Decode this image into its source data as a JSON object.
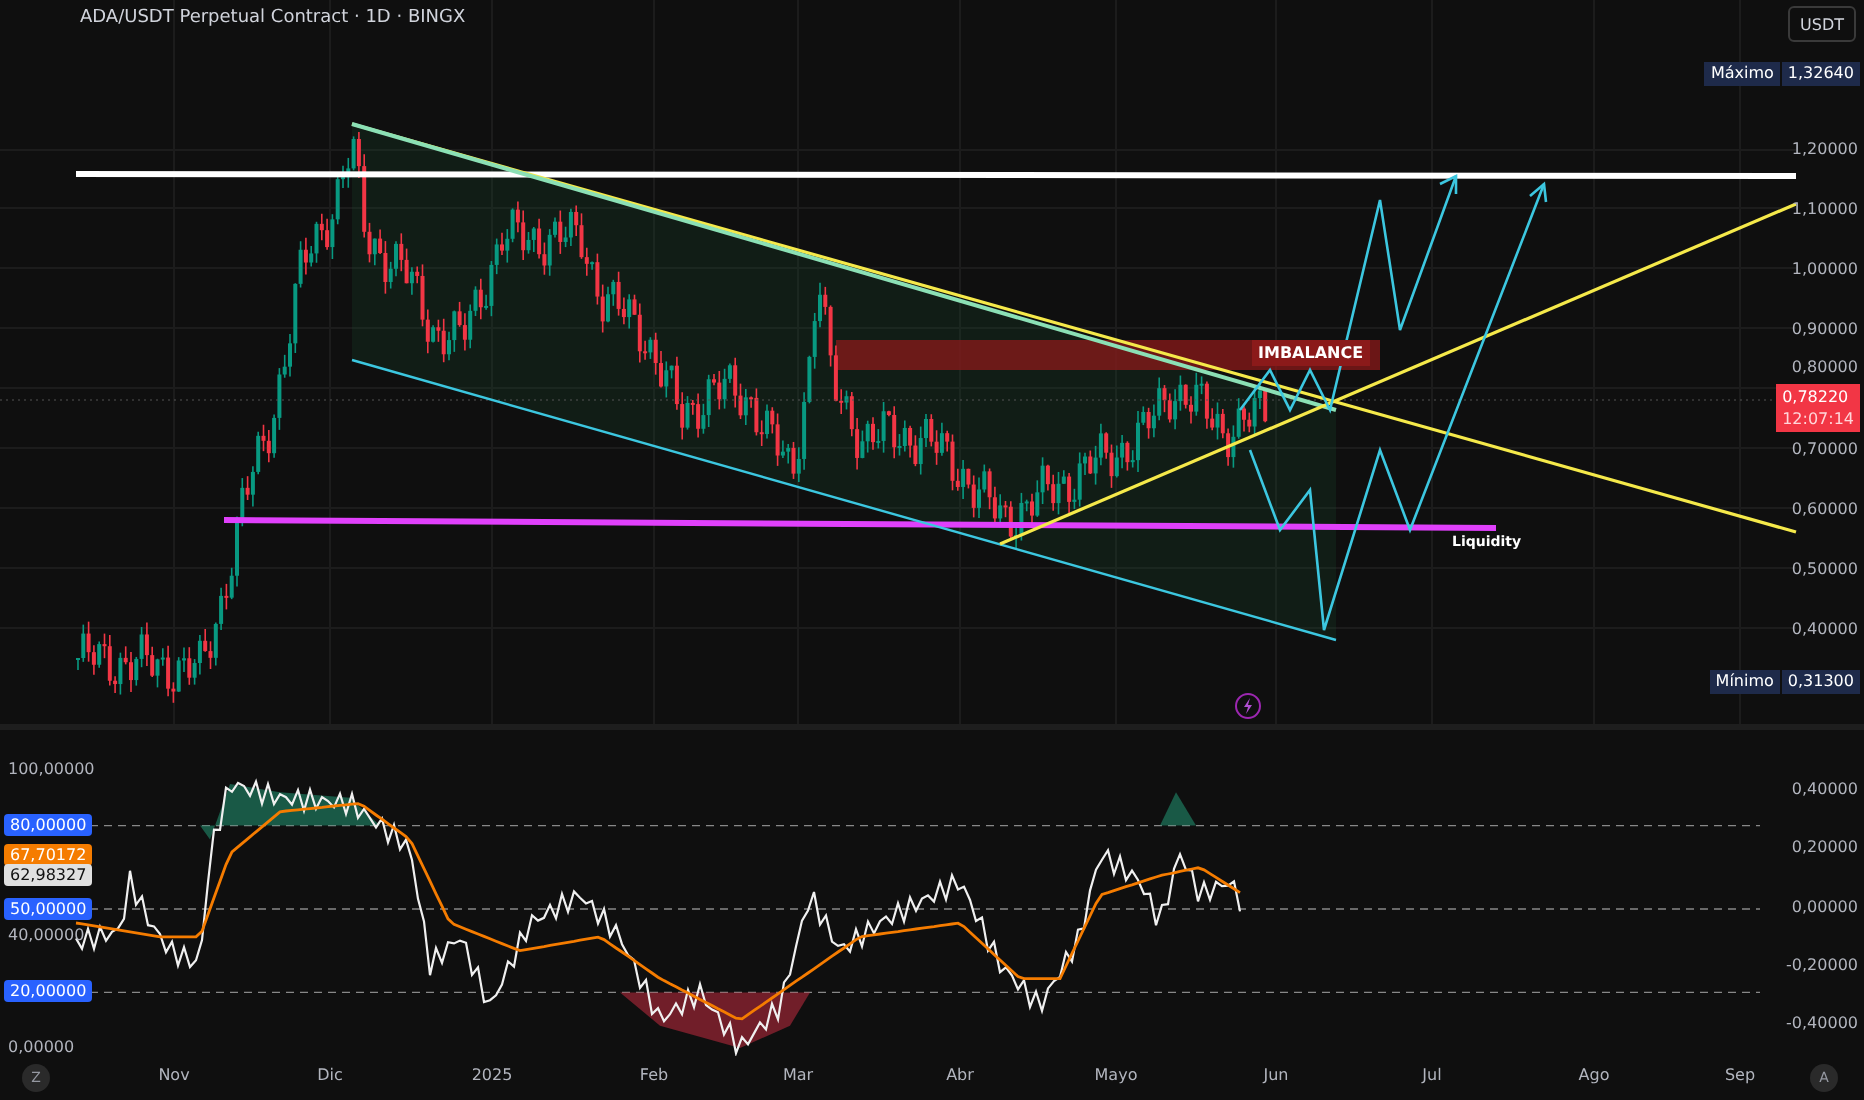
{
  "header": {
    "title": "ADA/USDT Perpetual Contract · 1D · BINGX",
    "currency_button": "USDT"
  },
  "price_axis": {
    "ticks": [
      "1,20000",
      "1,10000",
      "1,00000",
      "0,90000",
      "0,80000",
      "0,70000",
      "0,60000",
      "0,50000",
      "0,40000"
    ],
    "max_tag": {
      "label": "Máximo",
      "value": "1,32640"
    },
    "min_tag": {
      "label": "Mínimo",
      "value": "0,31300"
    },
    "last_price": {
      "value": "0,78220",
      "countdown": "12:07:14"
    }
  },
  "annotations": {
    "imbalance": "IMBALANCE",
    "liquidity": "Liquidity"
  },
  "indicator": {
    "left_ticks": [
      "100,00000",
      "40,00000",
      "0,00000"
    ],
    "badges": [
      {
        "value": "80,00000",
        "color": "#2962ff"
      },
      {
        "value": "67,70172",
        "color": "#f57c00"
      },
      {
        "value": "62,98327",
        "color": "#e0e0e0"
      },
      {
        "value": "50,00000",
        "color": "#2962ff"
      },
      {
        "value": "20,00000",
        "color": "#2962ff"
      }
    ],
    "right_ticks": [
      "0,40000",
      "0,20000",
      "0,00000",
      "-0,20000",
      "-0,40000"
    ]
  },
  "time_axis": {
    "timezone_button": "Z",
    "labels": [
      "Nov",
      "Dic",
      "2025",
      "Feb",
      "Mar",
      "Abr",
      "Mayo",
      "Jun",
      "Jul",
      "Ago",
      "Sep"
    ],
    "auto_button": "A"
  }
}
